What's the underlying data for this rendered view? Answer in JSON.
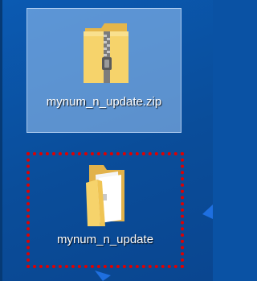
{
  "desktop": {
    "icons": [
      {
        "label": "mynum_n_update.zip",
        "icon": "zip-folder-icon",
        "selected": true
      },
      {
        "label": "mynum_n_update",
        "icon": "folder-icon",
        "highlighted": true
      }
    ]
  },
  "colors": {
    "desktop_background": "#0a52a4",
    "selection_fill": "#a0c8f5",
    "highlight_border": "#e00000",
    "folder_yellow": "#f6d36b",
    "arrow_blue": "#1e6fe0"
  }
}
